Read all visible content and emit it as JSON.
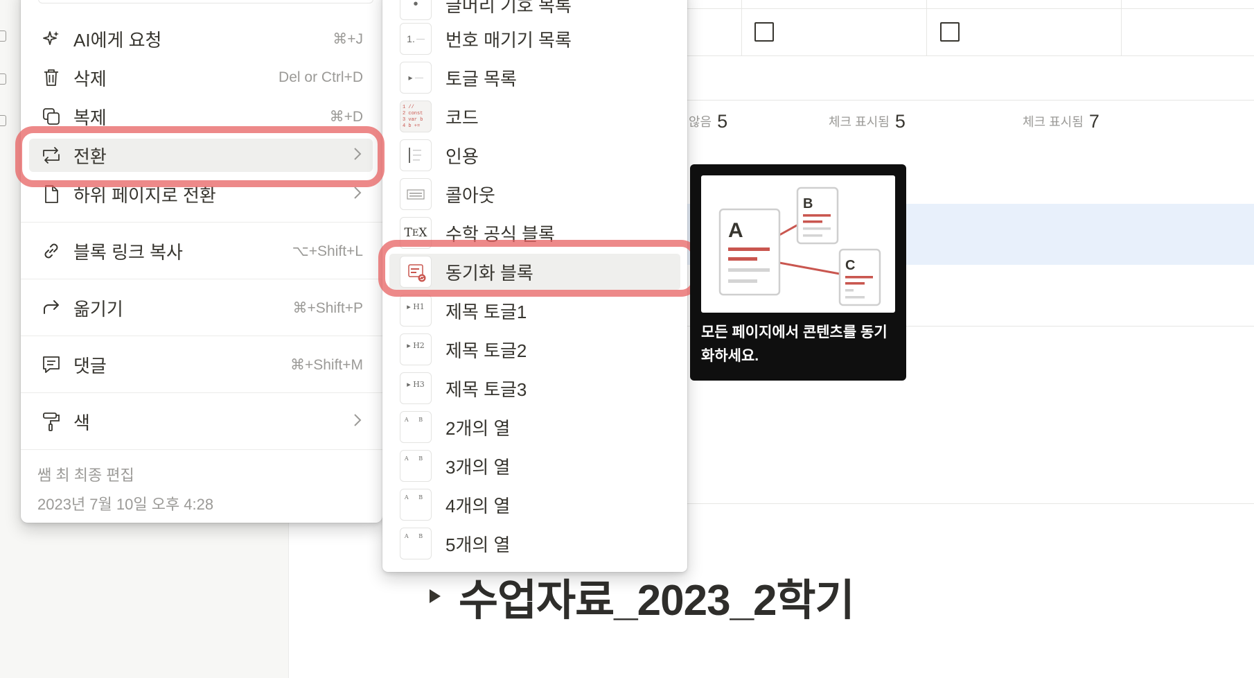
{
  "context_menu": {
    "items": [
      {
        "label": "AI에게 요청",
        "shortcut": "⌘+J",
        "icon": "sparkle-icon"
      },
      {
        "label": "삭제",
        "shortcut": "Del or Ctrl+D",
        "icon": "trash-icon"
      },
      {
        "label": "복제",
        "shortcut": "⌘+D",
        "icon": "duplicate-icon"
      },
      {
        "label": "전환",
        "shortcut": "",
        "icon": "turn-into-icon"
      },
      {
        "label": "하위 페이지로 전환",
        "shortcut": "",
        "icon": "page-icon"
      },
      {
        "label": "블록 링크 복사",
        "shortcut": "⌥+Shift+L",
        "icon": "link-icon"
      },
      {
        "label": "옮기기",
        "shortcut": "⌘+Shift+P",
        "icon": "move-arrow-icon"
      },
      {
        "label": "댓글",
        "shortcut": "⌘+Shift+M",
        "icon": "comment-icon"
      },
      {
        "label": "색",
        "shortcut": "",
        "icon": "paint-roller-icon"
      }
    ],
    "footer_editor": "쌤 최 최종 편집",
    "footer_date": "2023년 7월 10일 오후 4:28"
  },
  "turn_into_menu": {
    "items": [
      {
        "label": "글머리 기호 목록",
        "thumb": "•"
      },
      {
        "label": "번호 매기기 목록",
        "thumb": "1."
      },
      {
        "label": "토글 목록",
        "thumb": "▸"
      },
      {
        "label": "코드",
        "thumb": "code"
      },
      {
        "label": "인용",
        "thumb": "quote"
      },
      {
        "label": "콜아웃",
        "thumb": "callout"
      },
      {
        "label": "수학 공식 블록",
        "thumb": "TEX"
      },
      {
        "label": "동기화 블록",
        "thumb": "sync"
      },
      {
        "label": "제목 토글1",
        "thumb": "▸H1"
      },
      {
        "label": "제목 토글2",
        "thumb": "▸H2"
      },
      {
        "label": "제목 토글3",
        "thumb": "▸H3"
      },
      {
        "label": "2개의 열",
        "thumb": "A B"
      },
      {
        "label": "3개의 열",
        "thumb": "A B"
      },
      {
        "label": "4개의 열",
        "thumb": "A B"
      },
      {
        "label": "5개의 열",
        "thumb": "A B"
      }
    ]
  },
  "tooltip": {
    "text": "모든 페이지에서 콘텐츠를 동기화하세요.",
    "labels": [
      "A",
      "B",
      "C"
    ]
  },
  "table": {
    "calc": [
      {
        "label": "않음",
        "value": "5"
      },
      {
        "label": "체크 표시됨",
        "value": "5"
      },
      {
        "label": "체크 표시됨",
        "value": "7"
      }
    ]
  },
  "page": {
    "toggle_heading": "수업자료_2023_2학기"
  },
  "colors": {
    "highlight": "#e76262",
    "sync_red": "#c9564f",
    "tooltip_bg": "#0f0f0f"
  }
}
